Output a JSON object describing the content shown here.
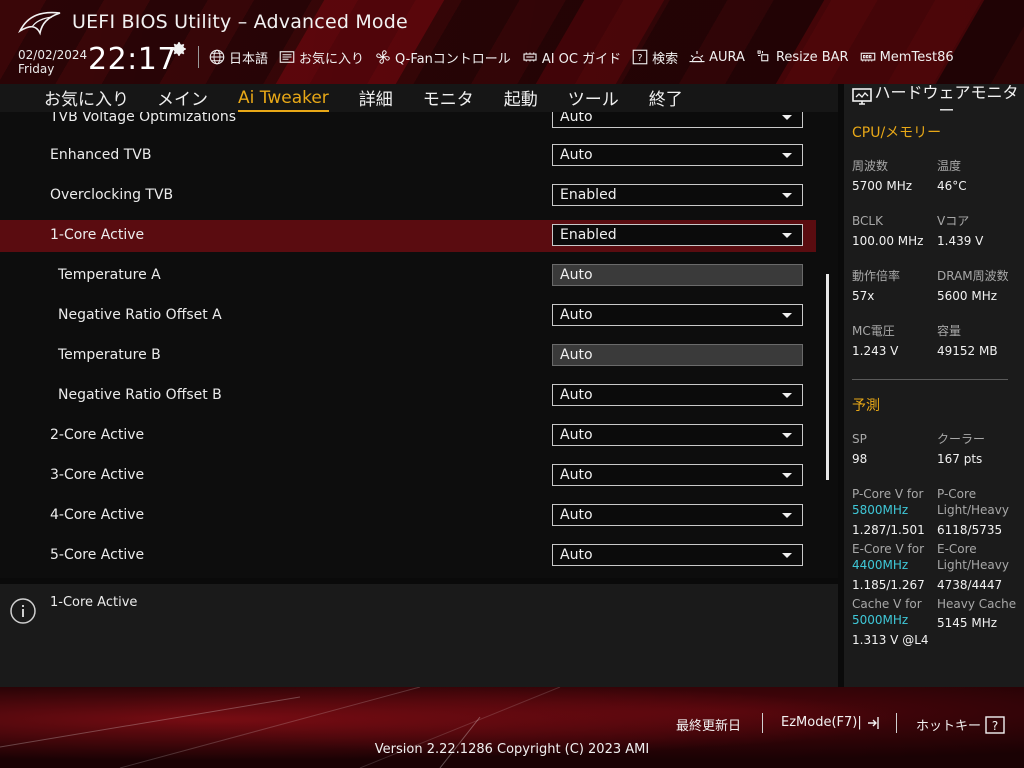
{
  "header": {
    "title": "UEFI BIOS Utility – Advanced Mode",
    "date": "02/02/2024",
    "weekday": "Friday",
    "time": "22:17"
  },
  "toolbar": {
    "language": "日本語",
    "favorites": "お気に入り",
    "qfan": "Q-Fanコントロール",
    "ai_oc": "AI OC ガイド",
    "search": "検索",
    "aura": "AURA",
    "resize_bar": "Resize BAR",
    "memtest": "MemTest86"
  },
  "tabs": [
    "お気に入り",
    "メイン",
    "Ai Tweaker",
    "詳細",
    "モニタ",
    "起動",
    "ツール",
    "終了"
  ],
  "active_tab": "Ai Tweaker",
  "settings": [
    {
      "label": "TVB Voltage Optimizations",
      "value": "Auto",
      "type": "dropdown"
    },
    {
      "label": "Enhanced TVB",
      "value": "Auto",
      "type": "dropdown"
    },
    {
      "label": "Overclocking TVB",
      "value": "Enabled",
      "type": "dropdown"
    },
    {
      "label": "1-Core Active",
      "value": "Enabled",
      "type": "dropdown",
      "selected": true
    },
    {
      "label": "Temperature A",
      "value": "Auto",
      "type": "input"
    },
    {
      "label": "Negative Ratio Offset A",
      "value": "Auto",
      "type": "dropdown"
    },
    {
      "label": "Temperature B",
      "value": "Auto",
      "type": "input"
    },
    {
      "label": "Negative Ratio Offset B",
      "value": "Auto",
      "type": "dropdown"
    },
    {
      "label": "2-Core Active",
      "value": "Auto",
      "type": "dropdown"
    },
    {
      "label": "3-Core Active",
      "value": "Auto",
      "type": "dropdown"
    },
    {
      "label": "4-Core Active",
      "value": "Auto",
      "type": "dropdown"
    },
    {
      "label": "5-Core Active",
      "value": "Auto",
      "type": "dropdown"
    }
  ],
  "help": {
    "text": "1-Core Active"
  },
  "hwmon": {
    "title": "ハードウェアモニター",
    "cpu_section": "CPU/メモリー",
    "freq_label": "周波数",
    "freq": "5700 MHz",
    "temp_label": "温度",
    "temp": "46°C",
    "bclk_label": "BCLK",
    "bclk": "100.00 MHz",
    "vcore_label": "Vコア",
    "vcore": "1.439 V",
    "ratio_label": "動作倍率",
    "ratio": "57x",
    "dram_label": "DRAM周波数",
    "dram": "5600 MHz",
    "mcv_label": "MC電圧",
    "mcv": "1.243 V",
    "cap_label": "容量",
    "cap": "49152 MB",
    "predict_section": "予測",
    "sp_label": "SP",
    "sp": "98",
    "cooler_label": "クーラー",
    "cooler": "167 pts",
    "pcore_label": "P-Core V for",
    "pcore_freq": "5800MHz",
    "pcore_v": "1.287/1.501",
    "pcore_lh_label1": "P-Core",
    "pcore_lh_label2": "Light/Heavy",
    "pcore_lh": "6118/5735",
    "ecore_label": "E-Core V for",
    "ecore_freq": "4400MHz",
    "ecore_v": "1.185/1.267",
    "ecore_lh_label1": "E-Core",
    "ecore_lh_label2": "Light/Heavy",
    "ecore_lh": "4738/4447",
    "cache_label": "Cache V for",
    "cache_freq": "5000MHz",
    "cache_v": "1.313 V @L4",
    "heavy_cache_label": "Heavy Cache",
    "heavy_cache": "5145 MHz",
    "accent": "#e8a817",
    "freq_color": "#3fc8d8"
  },
  "footer": {
    "last_modified": "最終更新日",
    "ezmode": "EzMode(F7)|",
    "hotkeys": "ホットキー",
    "version": "Version 2.22.1286 Copyright (C) 2023 AMI"
  },
  "colors": {
    "accent": "#e8a817",
    "selected_row": "#5a0c10",
    "brand_red": "#b3121c"
  }
}
